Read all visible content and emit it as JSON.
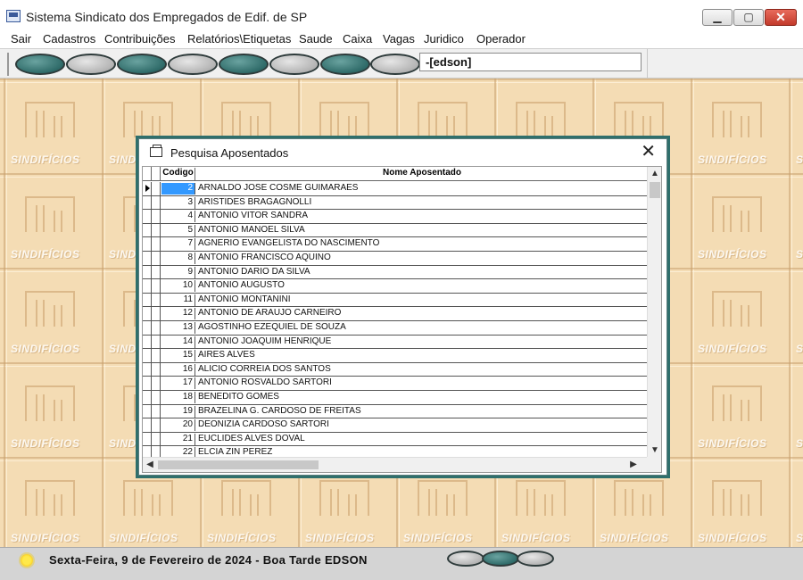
{
  "window": {
    "title": "Sistema Sindicato dos Empregados de Edif. de SP",
    "minimize": "▁",
    "maximize": "▢",
    "close": "✕"
  },
  "menu": [
    "Sair",
    "Cadastros",
    "Contribuições",
    "Relatórios\\Etiquetas",
    "Saude",
    "Caixa",
    "Vagas",
    "Juridico",
    "Operador"
  ],
  "toolbar": {
    "buttons": [
      "teal",
      "grey",
      "teal",
      "grey",
      "teal",
      "grey",
      "teal",
      "grey"
    ],
    "user_field": "-[edson]"
  },
  "desktop": {
    "watermark": "SINDIFÍCIOS"
  },
  "dialog": {
    "title": "Pesquisa Aposentados",
    "close": "✕",
    "columns": [
      "Codigo",
      "Nome Aposentado"
    ],
    "rows": [
      {
        "codigo": "2",
        "nome": "ARNALDO JOSE COSME GUIMARAES"
      },
      {
        "codigo": "3",
        "nome": "ARISTIDES BRAGAGNOLLI"
      },
      {
        "codigo": "4",
        "nome": "ANTONIO VITOR SANDRA"
      },
      {
        "codigo": "5",
        "nome": "ANTONIO MANOEL SILVA"
      },
      {
        "codigo": "7",
        "nome": "AGNERIO EVANGELISTA DO NASCIMENTO"
      },
      {
        "codigo": "8",
        "nome": "ANTONIO FRANCISCO AQUINO"
      },
      {
        "codigo": "9",
        "nome": "ANTONIO DARIO DA SILVA"
      },
      {
        "codigo": "10",
        "nome": "ANTONIO AUGUSTO"
      },
      {
        "codigo": "11",
        "nome": "ANTONIO MONTANINI"
      },
      {
        "codigo": "12",
        "nome": "ANTONIO DE ARAUJO CARNEIRO"
      },
      {
        "codigo": "13",
        "nome": "AGOSTINHO EZEQUIEL DE SOUZA"
      },
      {
        "codigo": "14",
        "nome": "ANTONIO JOAQUIM HENRIQUE"
      },
      {
        "codigo": "15",
        "nome": "AIRES ALVES"
      },
      {
        "codigo": "16",
        "nome": "ALICIO CORREIA DOS SANTOS"
      },
      {
        "codigo": "17",
        "nome": "ANTONIO ROSVALDO SARTORI"
      },
      {
        "codigo": "18",
        "nome": "BENEDITO GOMES"
      },
      {
        "codigo": "19",
        "nome": "BRAZELINA G. CARDOSO DE FREITAS"
      },
      {
        "codigo": "20",
        "nome": "DEONIZIA CARDOSO SARTORI"
      },
      {
        "codigo": "21",
        "nome": "EUCLIDES ALVES DOVAL"
      },
      {
        "codigo": "22",
        "nome": "ELCIA ZIN PEREZ"
      }
    ],
    "selected_row": "2"
  },
  "status": {
    "text": "Sexta-Feira,  9 de Fevereiro de 2024 - Boa Tarde  EDSON",
    "ovals": [
      "grey",
      "teal",
      "grey"
    ]
  }
}
